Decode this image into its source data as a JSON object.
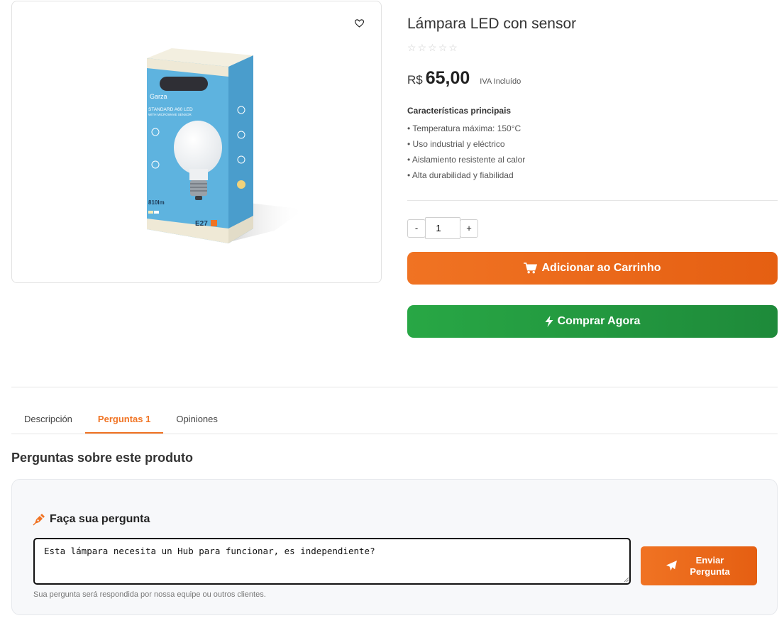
{
  "product": {
    "title": "Lámpara LED con sensor",
    "stars": [
      "☆",
      "☆",
      "☆",
      "☆",
      "☆"
    ],
    "rating": 0,
    "currency": "R$",
    "price": "65,00",
    "tax_note": "IVA Incluído",
    "image": {
      "brand": "Garza",
      "line1": "STANDARD A60 LED",
      "line2": "WITH MICROWAVE SENSOR",
      "lumens": "810lm",
      "socket": "E27"
    }
  },
  "features": {
    "title": "Características principais",
    "items": [
      "• Temperatura máxima: 150°C",
      "• Uso industrial y eléctrico",
      "• Aislamiento resistente al calor",
      "• Alta durabilidad y fiabilidad"
    ]
  },
  "quantity": {
    "minus": "-",
    "value": "1",
    "plus": "+"
  },
  "actions": {
    "add_to_cart": "Adicionar ao Carrinho",
    "buy_now": "Comprar Agora"
  },
  "tabs": [
    {
      "label": "Descripción",
      "active": false
    },
    {
      "label": "Perguntas 1",
      "active": true
    },
    {
      "label": "Opiniones",
      "active": false
    }
  ],
  "questions": {
    "section_title": "Perguntas sobre este produto",
    "ask_label": "Faça sua pergunta",
    "question_value": "Esta lámpara necesita un Hub para funcionar, es independiente?",
    "send_label": "Enviar Pergunta",
    "hint": "Sua pergunta será respondida por nossa equipe ou outros clientes."
  },
  "colors": {
    "accent": "#f07323",
    "buy": "#28a745",
    "card_bg": "#f7f8fa"
  }
}
